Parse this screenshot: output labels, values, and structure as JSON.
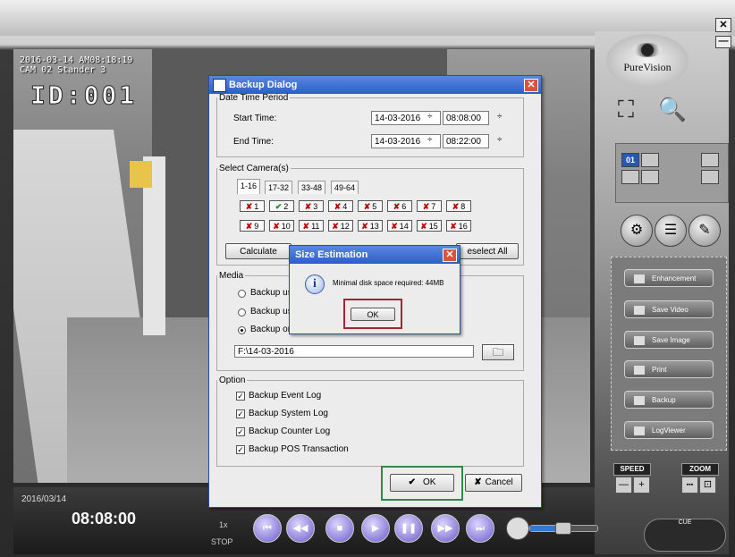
{
  "osd": {
    "line1": "2016-03-14 AM08:18:19",
    "line2": "CAM 02 Stander 3",
    "id_label": "ID:001"
  },
  "brand": {
    "name": "PureVision"
  },
  "window_controls": {
    "close": "✕",
    "minimize": "—"
  },
  "grid_selector": {
    "active": "01"
  },
  "side_menu": [
    {
      "label": "Enhancement"
    },
    {
      "label": "Save Video"
    },
    {
      "label": "Save Image"
    },
    {
      "label": "Print"
    },
    {
      "label": "Backup"
    },
    {
      "label": "LogViewer"
    }
  ],
  "speed_zoom": {
    "speed_label": "SPEED",
    "zoom_label": "ZOOM",
    "minus": "—",
    "plus": "+",
    "zoom_a": "▪▪▪",
    "zoom_b": "⊡"
  },
  "playback": {
    "date": "2016/03/14",
    "time": "08:08:00",
    "speed": "1x",
    "state": "STOP",
    "volume_level": 0.45,
    "cue_label": "CUE"
  },
  "backup_dialog": {
    "title": "Backup Dialog",
    "date_time_period": {
      "legend": "Date Time Period",
      "start_label": "Start Time:",
      "start_date": "14-03-2016",
      "start_time": "08:08:00",
      "end_label": "End Time:",
      "end_date": "14-03-2016",
      "end_time": "08:22:00"
    },
    "select_cameras": {
      "legend": "Select Camera(s)",
      "tabs": [
        "1-16",
        "17-32",
        "33-48",
        "49-64"
      ],
      "cameras": [
        {
          "n": "1",
          "selected": false
        },
        {
          "n": "2",
          "selected": true
        },
        {
          "n": "3",
          "selected": false
        },
        {
          "n": "4",
          "selected": false
        },
        {
          "n": "5",
          "selected": false
        },
        {
          "n": "6",
          "selected": false
        },
        {
          "n": "7",
          "selected": false
        },
        {
          "n": "8",
          "selected": false
        },
        {
          "n": "9",
          "selected": false
        },
        {
          "n": "10",
          "selected": false
        },
        {
          "n": "11",
          "selected": false
        },
        {
          "n": "12",
          "selected": false
        },
        {
          "n": "13",
          "selected": false
        },
        {
          "n": "14",
          "selected": false
        },
        {
          "n": "15",
          "selected": false
        },
        {
          "n": "16",
          "selected": false
        }
      ],
      "calculate_label": "Calculate",
      "deselect_label": "eselect All"
    },
    "media": {
      "legend": "Media",
      "option1": "Backup us",
      "option2": "Backup us",
      "option3": "Backup or",
      "path": "F:\\14-03-2016"
    },
    "option": {
      "legend": "Option",
      "items": [
        "Backup Event Log",
        "Backup System Log",
        "Backup Counter Log",
        "Backup POS Transaction"
      ]
    },
    "ok_label": "OK",
    "cancel_label": "Cancel"
  },
  "size_estimation": {
    "title": "Size Estimation",
    "message": "Minimal disk space required: 44MB",
    "ok_label": "OK"
  },
  "colors": {
    "title_blue": "#2d5ec6",
    "highlight_green": "#2e8a4a",
    "highlight_red": "#a5243a"
  }
}
